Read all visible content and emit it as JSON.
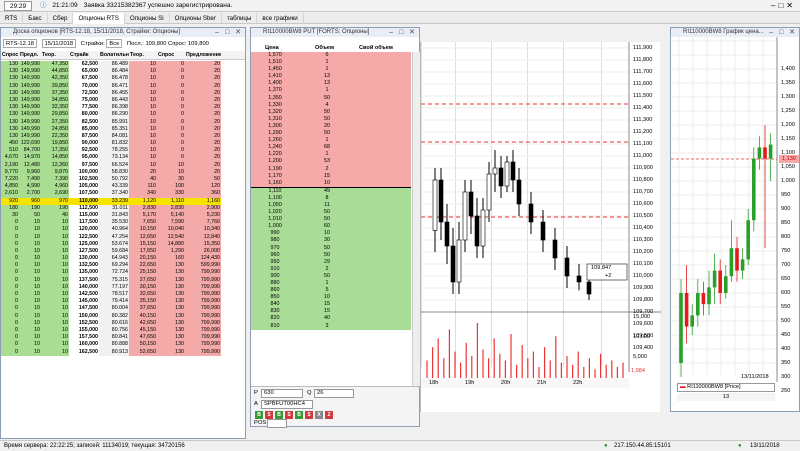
{
  "topbar": {
    "time": "29:29",
    "status_time": "21:21:09",
    "status_msg": "Заявка 33215382367 успешно зарегистрирована."
  },
  "tabs": [
    "RTS",
    "Бакс",
    "Сбер",
    "Опционы RTS",
    "Опционы Si",
    "Опционы Sber",
    "таблицы",
    "все графики"
  ],
  "tabs_active": 3,
  "desk": {
    "title": "Доска опционов [RTS-12.18, 15/11/2018, Страйки: Опционы]",
    "filters": {
      "underlying": "RTS-12.18",
      "expiry": "15/11/2018",
      "strikes_label": "Страйки:",
      "strikes_value": "Все",
      "last": "Посл.: 109,800",
      "bid": "Спрос: 109,800"
    },
    "headers": [
      "Спрос",
      "Предл.",
      "Теор. цена",
      "Страйк",
      "Волатильность",
      "Теор. цена",
      "Спрос",
      "Предложение"
    ],
    "rows": [
      [
        "130",
        "149,990",
        "47,350",
        "62,500",
        "86.489",
        "10",
        "0",
        "20"
      ],
      [
        "130",
        "149,990",
        "44,850",
        "65,000",
        "86.484",
        "10",
        "0",
        "20"
      ],
      [
        "130",
        "149,990",
        "42,350",
        "67,500",
        "86.478",
        "10",
        "0",
        "20"
      ],
      [
        "130",
        "149,990",
        "39,850",
        "70,000",
        "86.471",
        "10",
        "0",
        "20"
      ],
      [
        "130",
        "149,990",
        "37,350",
        "72,500",
        "86.455",
        "10",
        "0",
        "20"
      ],
      [
        "130",
        "149,990",
        "34,850",
        "75,000",
        "86.443",
        "10",
        "0",
        "20"
      ],
      [
        "130",
        "149,990",
        "32,350",
        "77,500",
        "86.398",
        "10",
        "0",
        "20"
      ],
      [
        "130",
        "149,990",
        "29,850",
        "80,000",
        "86.290",
        "10",
        "0",
        "20"
      ],
      [
        "130",
        "149,990",
        "27,350",
        "82,500",
        "85.991",
        "10",
        "0",
        "20"
      ],
      [
        "130",
        "149,990",
        "24,850",
        "85,000",
        "85.351",
        "10",
        "0",
        "20"
      ],
      [
        "130",
        "149,990",
        "22,350",
        "87,500",
        "84.081",
        "10",
        "0",
        "20"
      ],
      [
        "450",
        "122,690",
        "19,850",
        "90,000",
        "81.832",
        "10",
        "0",
        "20"
      ],
      [
        "510",
        "84,700",
        "17,350",
        "92,500",
        "78.255",
        "10",
        "0",
        "20"
      ],
      [
        "4,670",
        "14,970",
        "14,850",
        "95,000",
        "73.134",
        "10",
        "0",
        "20"
      ],
      [
        "2,190",
        "12,480",
        "12,360",
        "97,500",
        "66.524",
        "10",
        "10",
        "20"
      ],
      [
        "9,770",
        "9,960",
        "9,870",
        "100,000",
        "58.830",
        "20",
        "10",
        "20"
      ],
      [
        "7,220",
        "7,490",
        "7,390",
        "102,500",
        "50.792",
        "40",
        "30",
        "50"
      ],
      [
        "4,850",
        "4,990",
        "4,960",
        "105,000",
        "43.339",
        "110",
        "100",
        "120"
      ],
      [
        "2,610",
        "2,700",
        "2,690",
        "107,500",
        "37.340",
        "340",
        "330",
        "360"
      ],
      [
        "920",
        "960",
        "970",
        "110,000",
        "33.239",
        "1,120",
        "1,110",
        "1,160"
      ],
      [
        "180",
        "190",
        "190",
        "112,500",
        "31.011",
        "2,830",
        "2,830",
        "2,900"
      ],
      [
        "30",
        "50",
        "40",
        "115,000",
        "31.843",
        "5,170",
        "5,140",
        "5,230"
      ],
      [
        "0",
        "10",
        "10",
        "117,500",
        "35.530",
        "7,650",
        "7,590",
        "7,760"
      ],
      [
        "0",
        "10",
        "10",
        "120,000",
        "40.964",
        "10,150",
        "10,040",
        "10,340"
      ],
      [
        "0",
        "10",
        "10",
        "122,500",
        "47.254",
        "12,650",
        "12,540",
        "12,840"
      ],
      [
        "0",
        "10",
        "10",
        "125,000",
        "53.674",
        "15,150",
        "14,880",
        "15,350"
      ],
      [
        "0",
        "10",
        "10",
        "127,500",
        "59.684",
        "17,650",
        "1,290",
        "26,000"
      ],
      [
        "0",
        "10",
        "10",
        "130,000",
        "64.943",
        "20,150",
        "160",
        "124,430"
      ],
      [
        "0",
        "10",
        "10",
        "132,500",
        "69.294",
        "22,650",
        "130",
        "599,990"
      ],
      [
        "0",
        "10",
        "10",
        "135,000",
        "72.724",
        "25,150",
        "130",
        "799,990"
      ],
      [
        "0",
        "10",
        "10",
        "137,500",
        "75.315",
        "27,650",
        "130",
        "799,990"
      ],
      [
        "0",
        "10",
        "10",
        "140,000",
        "77.197",
        "30,150",
        "130",
        "799,990"
      ],
      [
        "0",
        "10",
        "10",
        "142,500",
        "78.517",
        "32,650",
        "130",
        "799,990"
      ],
      [
        "0",
        "10",
        "10",
        "145,000",
        "79.414",
        "35,150",
        "130",
        "799,990"
      ],
      [
        "0",
        "10",
        "10",
        "147,500",
        "80.004",
        "37,650",
        "130",
        "799,990"
      ],
      [
        "0",
        "10",
        "10",
        "150,000",
        "80.382",
        "40,150",
        "130",
        "799,990"
      ],
      [
        "0",
        "10",
        "10",
        "152,500",
        "80.616",
        "42,650",
        "130",
        "799,990"
      ],
      [
        "0",
        "10",
        "10",
        "155,000",
        "80.756",
        "45,150",
        "130",
        "799,990"
      ],
      [
        "0",
        "10",
        "10",
        "157,500",
        "80.841",
        "47,650",
        "130",
        "799,990"
      ],
      [
        "0",
        "10",
        "10",
        "160,000",
        "80.888",
        "50,150",
        "130",
        "799,990"
      ],
      [
        "0",
        "10",
        "10",
        "162,500",
        "80.913",
        "52,650",
        "130",
        "799,990"
      ]
    ],
    "highlight_row": 19
  },
  "book": {
    "title": "RI110000BW8 PUT [FORTS: Опционы]",
    "headers": [
      "Цена",
      "Объем",
      "Свой объем"
    ],
    "sell": [
      [
        "1,570",
        "6"
      ],
      [
        "1,510",
        "1"
      ],
      [
        "1,450",
        "1"
      ],
      [
        "1,410",
        "13"
      ],
      [
        "1,400",
        "13"
      ],
      [
        "1,370",
        "1"
      ],
      [
        "1,350",
        "50"
      ],
      [
        "1,330",
        "4"
      ],
      [
        "1,320",
        "50"
      ],
      [
        "1,310",
        "50"
      ],
      [
        "1,300",
        "20"
      ],
      [
        "1,290",
        "50"
      ],
      [
        "1,260",
        "1"
      ],
      [
        "1,240",
        "68"
      ],
      [
        "1,220",
        "1"
      ],
      [
        "1,200",
        "53"
      ],
      [
        "1,190",
        "2"
      ],
      [
        "1,170",
        "15"
      ],
      [
        "1,160",
        "10"
      ]
    ],
    "buy": [
      [
        "1,110",
        "49"
      ],
      [
        "1,100",
        "8"
      ],
      [
        "1,050",
        "11"
      ],
      [
        "1,020",
        "50"
      ],
      [
        "1,010",
        "50"
      ],
      [
        "1,000",
        "60"
      ],
      [
        "990",
        "10"
      ],
      [
        "980",
        "30"
      ],
      [
        "970",
        "50"
      ],
      [
        "960",
        "50"
      ],
      [
        "950",
        "29"
      ],
      [
        "910",
        "2"
      ],
      [
        "900",
        "50"
      ],
      [
        "880",
        "1"
      ],
      [
        "860",
        "5"
      ],
      [
        "850",
        "10"
      ],
      [
        "840",
        "15"
      ],
      [
        "830",
        "15"
      ],
      [
        "820",
        "40"
      ],
      [
        "810",
        "3"
      ]
    ],
    "form": {
      "price_label": "P",
      "price": "630",
      "qty_label": "Q",
      "qty": "26",
      "account_label": "A",
      "account": "SPBFUT00HC4",
      "pos_label": "POS"
    },
    "buttons": [
      "B",
      "S",
      "B",
      "S",
      "B",
      "S",
      "X",
      "Z"
    ]
  },
  "chart": {
    "price_labels": [
      "111,900",
      "111,800",
      "111,700",
      "111,600",
      "111,500",
      "111,400",
      "111,300",
      "111,200",
      "111,100",
      "111,000",
      "110,900",
      "110,800",
      "110,700",
      "110,600",
      "110,500",
      "110,400",
      "110,300",
      "110,200",
      "110,100",
      "110,000",
      "109,900",
      "109,800",
      "109,700",
      "109,600",
      "109,500",
      "109,400"
    ],
    "last_label": "109,847",
    "last_sub": "+2",
    "volume_labels": [
      "15,000",
      "10,000",
      "5,000"
    ],
    "volume_last": "1,984",
    "time_labels": [
      "18h",
      "19h",
      "20h",
      "21h",
      "22h"
    ]
  },
  "right": {
    "title": "RI110000BW8 График цена...",
    "price_labels": [
      "1,400",
      "1,350",
      "1,300",
      "1,250",
      "1,200",
      "1,150",
      "1,100",
      "1,050",
      "1,000",
      "950",
      "900",
      "850",
      "800",
      "750",
      "700",
      "650",
      "600",
      "550",
      "500",
      "450",
      "400",
      "350",
      "300",
      "250"
    ],
    "last_label": "1,130",
    "legend": "RI110000BW8 [Price]",
    "legend_value": "13",
    "date_label": "13/11/2018"
  },
  "statusbar": {
    "server_time": "Время сервера: 22:22:25; записей: 11134019; текущая: 34720156",
    "ip": "217.150.44.85:15101",
    "date": "13/11/2018"
  },
  "colors": {
    "sell": "#f5a9a9",
    "buy": "#a9dd97",
    "call_itm": "#a8dd92",
    "highlight": "#f6e300",
    "candle_up": "#2aa02a",
    "candle_down": "#e01c1c"
  }
}
